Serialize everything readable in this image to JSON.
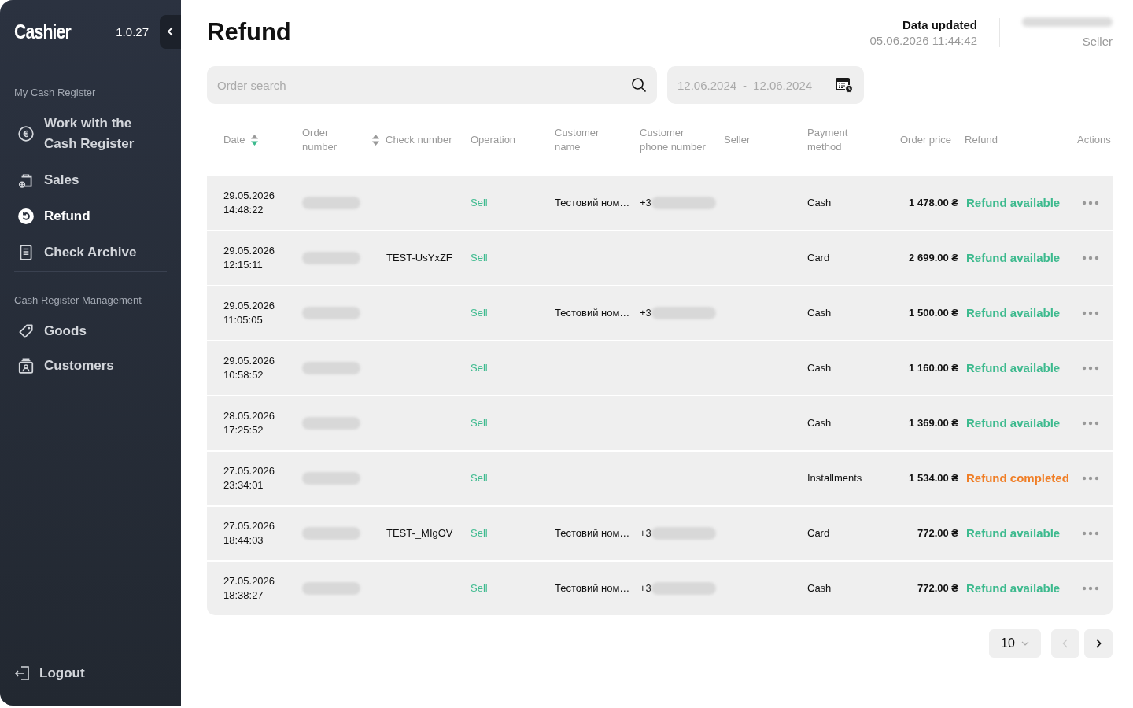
{
  "sidebar": {
    "logo": "Cashier",
    "version": "1.0.27",
    "sections": [
      {
        "title": "My Cash Register",
        "items": [
          {
            "label": "Work with the Cash Register",
            "selected": false
          },
          {
            "label": "Sales",
            "selected": false
          },
          {
            "label": "Refund",
            "selected": true
          },
          {
            "label": "Check Archive",
            "selected": false
          }
        ]
      },
      {
        "title": "Cash Register Management",
        "items": [
          {
            "label": "Goods",
            "selected": false
          },
          {
            "label": "Customers",
            "selected": false
          }
        ]
      }
    ],
    "logout": "Logout"
  },
  "header": {
    "title": "Refund",
    "updated_label": "Data updated",
    "updated_time": "05.06.2026 11:44:42",
    "user_role": "Seller"
  },
  "search": {
    "placeholder": "Order search"
  },
  "date_range": {
    "from": "12.06.2024",
    "separator": "-",
    "to": "12.06.2024"
  },
  "table": {
    "columns": [
      {
        "label": "Date",
        "sorted": true
      },
      {
        "label": "Order number"
      },
      {
        "label": "Check number",
        "sorted": false
      },
      {
        "label": "Operation"
      },
      {
        "label": "Customer name"
      },
      {
        "label": "Customer phone number"
      },
      {
        "label": "Seller"
      },
      {
        "label": "Payment method"
      },
      {
        "label": "Order price"
      },
      {
        "label": "Refund"
      },
      {
        "label": "Actions"
      }
    ],
    "rows": [
      {
        "date": "29.05.2026",
        "time": "14:48:22",
        "check": "",
        "operation": "Sell",
        "customer": "Тестовий ном…",
        "phone": "+3",
        "payment": "Cash",
        "price": "1 478.00 ₴",
        "refund": {
          "text": "Refund available",
          "kind": "available"
        }
      },
      {
        "date": "29.05.2026",
        "time": "12:15:11",
        "check": "TEST-UsYxZF",
        "operation": "Sell",
        "customer": "",
        "phone": "",
        "payment": "Card",
        "price": "2 699.00 ₴",
        "refund": {
          "text": "Refund available",
          "kind": "available"
        }
      },
      {
        "date": "29.05.2026",
        "time": "11:05:05",
        "check": "",
        "operation": "Sell",
        "customer": "Тестовий ном…",
        "phone": "+3",
        "payment": "Cash",
        "price": "1 500.00 ₴",
        "refund": {
          "text": "Refund available",
          "kind": "available"
        }
      },
      {
        "date": "29.05.2026",
        "time": "10:58:52",
        "check": "",
        "operation": "Sell",
        "customer": "",
        "phone": "",
        "payment": "Cash",
        "price": "1 160.00 ₴",
        "refund": {
          "text": "Refund available",
          "kind": "available"
        }
      },
      {
        "date": "28.05.2026",
        "time": "17:25:52",
        "check": "",
        "operation": "Sell",
        "customer": "",
        "phone": "",
        "payment": "Cash",
        "price": "1 369.00 ₴",
        "refund": {
          "text": "Refund available",
          "kind": "available"
        }
      },
      {
        "date": "27.05.2026",
        "time": "23:34:01",
        "check": "",
        "operation": "Sell",
        "customer": "",
        "phone": "",
        "payment": "Installments",
        "price": "1 534.00 ₴",
        "refund": {
          "text": "Refund completed",
          "kind": "completed"
        }
      },
      {
        "date": "27.05.2026",
        "time": "18:44:03",
        "check": "TEST-_MIgOV",
        "operation": "Sell",
        "customer": "Тестовий ном…",
        "phone": "+3",
        "payment": "Card",
        "price": "772.00 ₴",
        "refund": {
          "text": "Refund available",
          "kind": "available"
        }
      },
      {
        "date": "27.05.2026",
        "time": "18:38:27",
        "check": "",
        "operation": "Sell",
        "customer": "Тестовий ном…",
        "phone": "+3",
        "payment": "Cash",
        "price": "772.00 ₴",
        "refund": {
          "text": "Refund available",
          "kind": "available"
        }
      }
    ]
  },
  "pagination": {
    "page_size": "10"
  }
}
